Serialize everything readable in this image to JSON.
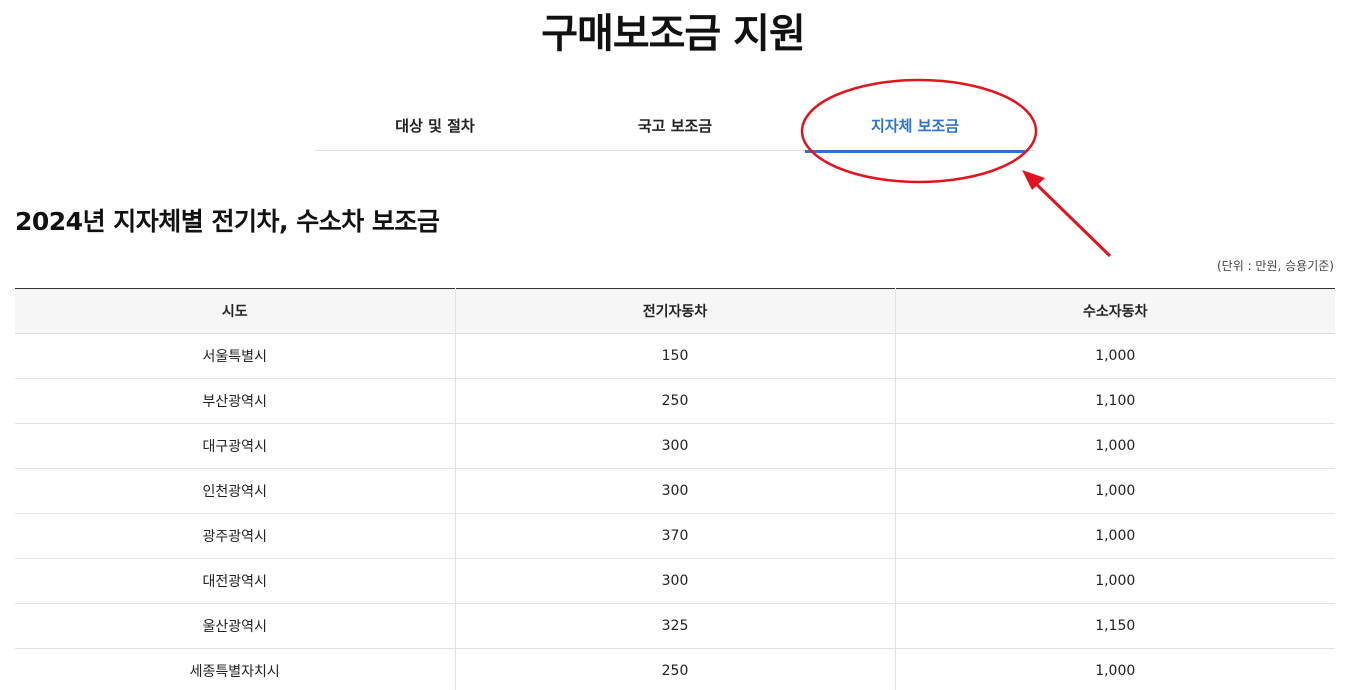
{
  "page": {
    "title": "구매보조금 지원"
  },
  "tabs": [
    {
      "label": "대상 및 절차",
      "active": false
    },
    {
      "label": "국고 보조금",
      "active": false
    },
    {
      "label": "지자체 보조금",
      "active": true
    }
  ],
  "section": {
    "title": "2024년 지자체별 전기차, 수소차 보조금",
    "unit_note": "(단위 : 만원, 승용기준)"
  },
  "table": {
    "headers": [
      "시도",
      "전기자동차",
      "수소자동차"
    ],
    "rows": [
      [
        "서울특별시",
        "150",
        "1,000"
      ],
      [
        "부산광역시",
        "250",
        "1,100"
      ],
      [
        "대구광역시",
        "300",
        "1,000"
      ],
      [
        "인천광역시",
        "300",
        "1,000"
      ],
      [
        "광주광역시",
        "370",
        "1,000"
      ],
      [
        "대전광역시",
        "300",
        "1,000"
      ],
      [
        "울산광역시",
        "325",
        "1,150"
      ],
      [
        "세종특별자치시",
        "250",
        "1,000"
      ]
    ]
  },
  "colors": {
    "accent": "#2f73c9",
    "annotation": "#e0141e",
    "header_bg": "#f6f6f6"
  }
}
